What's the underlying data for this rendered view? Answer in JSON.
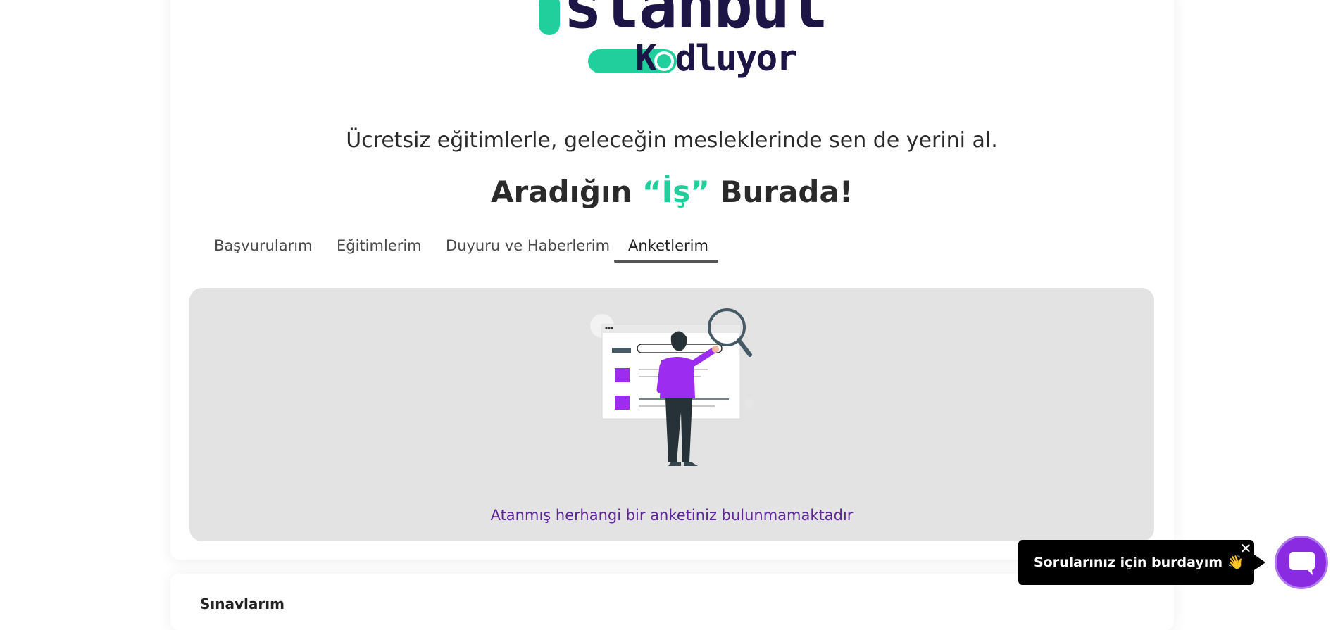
{
  "brand": {
    "logo_line1": "stanbul",
    "logo_line2_first": "K",
    "logo_line2_rest": "dluyor",
    "accent_color": "#20cf9b",
    "dark_color": "#1c1545"
  },
  "hero": {
    "subtitle": "Ücretsiz eğitimlerle, geleceğin mesleklerinde sen de yerini al.",
    "tagline_before": "Aradığın",
    "tagline_highlight": "“İş”",
    "tagline_after": "Burada!"
  },
  "tabs": [
    {
      "label": "Başvurularım",
      "active": false
    },
    {
      "label": "Eğitimlerim",
      "active": false
    },
    {
      "label": "Duyuru ve Haberlerim",
      "active": false
    },
    {
      "label": "Anketlerim",
      "active": true
    }
  ],
  "surveys": {
    "empty_message": "Atanmış herhangi bir anketiniz bulunmamaktadır",
    "illustration_icon": "person-searching-illustration"
  },
  "next_section": {
    "title": "Sınavlarım"
  },
  "chat": {
    "bubble_text": "Sorularınız için burdayım 👋",
    "close_symbol": "✕",
    "fab_icon": "chat-bubble-icon",
    "fab_color": "#8a2be2"
  }
}
